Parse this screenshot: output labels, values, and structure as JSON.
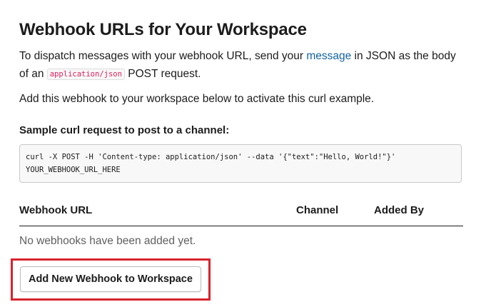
{
  "header": {
    "title": "Webhook URLs for Your Workspace"
  },
  "intro": {
    "text_before_link": "To dispatch messages with your webhook URL, send your ",
    "link_label": "message",
    "text_after_link": " in JSON as the body of an ",
    "inline_code": "application/json",
    "text_end": " POST request."
  },
  "activate_text": "Add this webhook to your workspace below to activate this curl example.",
  "sample": {
    "label": "Sample curl request to post to a channel:",
    "code_line_1": "curl -X POST -H 'Content-type: application/json' --data '{\"text\":\"Hello, World!\"}'",
    "code_line_2": "YOUR_WEBHOOK_URL_HERE"
  },
  "table": {
    "columns": [
      "Webhook URL",
      "Channel",
      "Added By"
    ],
    "empty_message": "No webhooks have been added yet."
  },
  "actions": {
    "add_button_label": "Add New Webhook to Workspace"
  },
  "colors": {
    "link": "#1264a3",
    "inline_code": "#e01e5a",
    "highlight_border": "#d9232d",
    "text": "#1d1c1d",
    "muted_text": "#616061"
  }
}
